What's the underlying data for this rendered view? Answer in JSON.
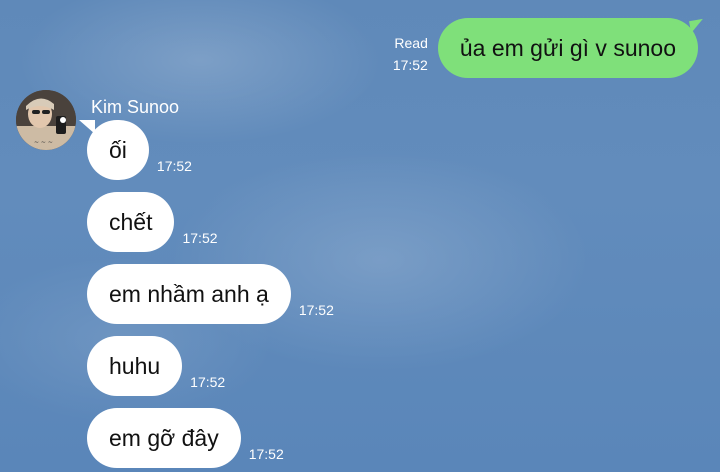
{
  "outgoing": {
    "text": "ủa em gửi gì v sunoo",
    "status": "Read",
    "time": "17:52"
  },
  "contact": {
    "name": "Kim Sunoo"
  },
  "incoming": [
    {
      "text": "ối",
      "time": "17:52"
    },
    {
      "text": "chết",
      "time": "17:52"
    },
    {
      "text": "em nhầm anh ạ",
      "time": "17:52"
    },
    {
      "text": "huhu",
      "time": "17:52"
    },
    {
      "text": "em gỡ đây",
      "time": "17:52"
    }
  ],
  "colors": {
    "outgoing_bubble": "#7fe07a",
    "incoming_bubble": "#ffffff",
    "background": "#5f89b9"
  }
}
